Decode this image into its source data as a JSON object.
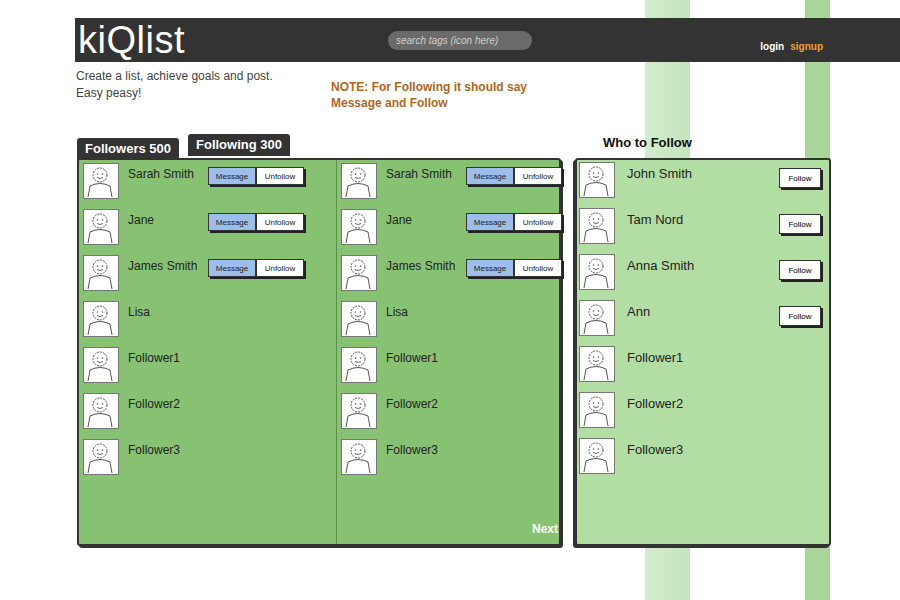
{
  "header": {
    "logo": "kiQlist",
    "search": {
      "placeholder": "search tags (icon here)"
    },
    "auth": [
      {
        "label": "login",
        "kind": "plain"
      },
      {
        "label": "signup",
        "kind": "accent"
      }
    ]
  },
  "tagline": [
    "Create a list, achieve goals and post.",
    "Easy peasy!"
  ],
  "note": [
    "NOTE: For Following it should say",
    "Message and Follow"
  ],
  "tabs": [
    {
      "label": "Followers",
      "count": "500",
      "selected": true
    },
    {
      "label": "Following",
      "count": "300",
      "selected": false
    }
  ],
  "columns": [
    [
      {
        "name": "Sarah Smith",
        "actions": [
          {
            "label": "Message",
            "kind": "primary"
          },
          {
            "label": "Unfollow",
            "kind": "secondary"
          }
        ]
      },
      {
        "name": "Jane",
        "actions": [
          {
            "label": "Message",
            "kind": "primary"
          },
          {
            "label": "Unfollow",
            "kind": "secondary"
          }
        ]
      },
      {
        "name": "James Smith",
        "actions": [
          {
            "label": "Message",
            "kind": "primary"
          },
          {
            "label": "Unfollow",
            "kind": "secondary"
          }
        ]
      },
      {
        "name": "Lisa",
        "actions": []
      },
      {
        "name": "Follower1",
        "actions": []
      },
      {
        "name": "Follower2",
        "actions": []
      },
      {
        "name": "Follower3",
        "actions": []
      }
    ],
    [
      {
        "name": "Sarah Smith",
        "actions": [
          {
            "label": "Message",
            "kind": "primary"
          },
          {
            "label": "Unfollow",
            "kind": "secondary"
          }
        ]
      },
      {
        "name": "Jane",
        "actions": [
          {
            "label": "Message",
            "kind": "primary"
          },
          {
            "label": "Unfollow",
            "kind": "secondary"
          }
        ]
      },
      {
        "name": "James Smith",
        "actions": [
          {
            "label": "Message",
            "kind": "primary"
          },
          {
            "label": "Unfollow",
            "kind": "secondary"
          }
        ]
      },
      {
        "name": "Lisa",
        "actions": []
      },
      {
        "name": "Follower1",
        "actions": []
      },
      {
        "name": "Follower2",
        "actions": []
      },
      {
        "name": "Follower3",
        "actions": []
      }
    ]
  ],
  "next": "Next",
  "whoToFollow": {
    "title": "Who to Follow",
    "people": [
      {
        "name": "John Smith",
        "action": "Follow"
      },
      {
        "name": "Tam Nord",
        "action": "Follow"
      },
      {
        "name": "Anna Smith",
        "action": "Follow"
      },
      {
        "name": "Ann",
        "action": "Follow"
      },
      {
        "name": "Follower1",
        "action": ""
      },
      {
        "name": "Follower2",
        "action": ""
      },
      {
        "name": "Follower3",
        "action": ""
      }
    ]
  }
}
